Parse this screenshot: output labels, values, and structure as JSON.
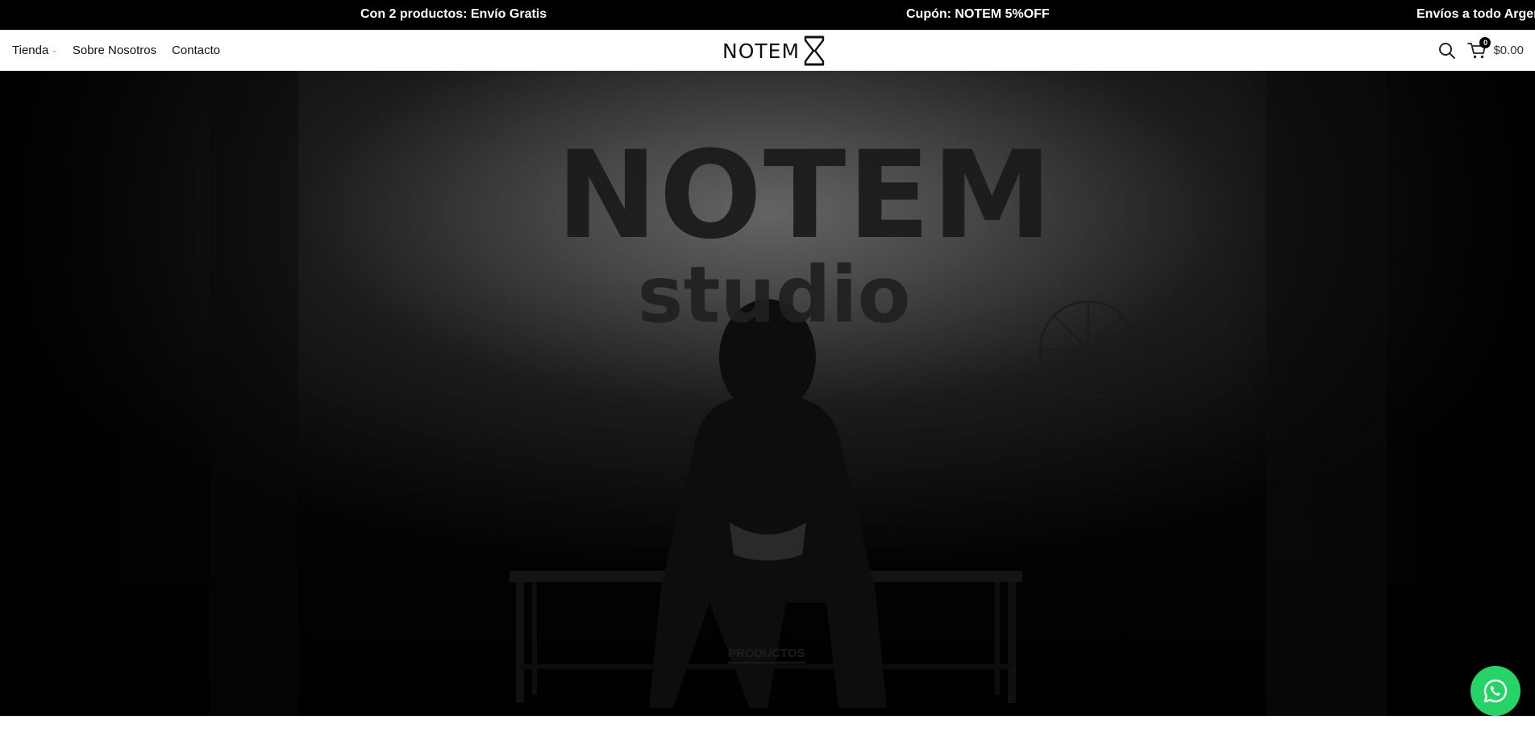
{
  "announcements": [
    "Con 2 productos: Envío Gratis",
    "Cupón: NOTEM 5%OFF",
    "Envíos a todo Argentina"
  ],
  "nav": {
    "items": [
      {
        "label": "Tienda",
        "has_dropdown": true
      },
      {
        "label": "Sobre Nosotros",
        "has_dropdown": false
      },
      {
        "label": "Contacto",
        "has_dropdown": false
      }
    ]
  },
  "logo": {
    "text": "NOTEM",
    "icon": "hourglass-icon"
  },
  "header_actions": {
    "search_icon": "search-icon",
    "cart_icon": "cart-icon",
    "cart_count": "0",
    "cart_total": "$0.00"
  },
  "hero": {
    "wall_title": "NOTEM",
    "wall_subtitle": "studio",
    "cta_label": "PRODUCTOS"
  },
  "floating": {
    "whatsapp_icon": "whatsapp-icon"
  },
  "colors": {
    "topbar_bg": "#000000",
    "whatsapp": "#25d366",
    "hero_bg": "#050505"
  }
}
